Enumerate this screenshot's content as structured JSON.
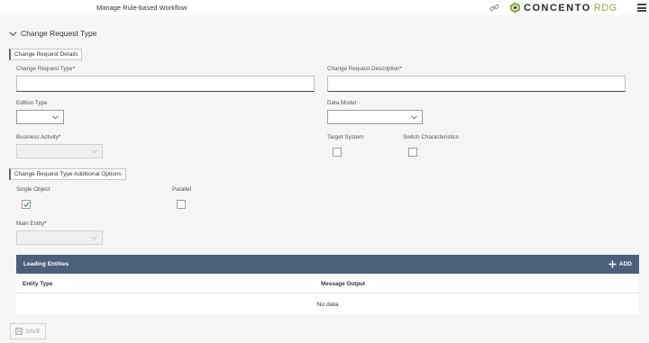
{
  "header": {
    "title": "Manage Rule-based Workflow",
    "brand": "CONCENTO",
    "brand_suffix": "RDG"
  },
  "section": {
    "title": "Change Request Type"
  },
  "details_group": {
    "label": "Change Request Details"
  },
  "fields": {
    "cr_type": {
      "label": "Change Request Type",
      "required": "*",
      "value": ""
    },
    "cr_description": {
      "label": "Change Request Description",
      "required": "*",
      "value": ""
    },
    "edition_type": {
      "label": "Edition Type",
      "value": ""
    },
    "data_model": {
      "label": "Data Model",
      "value": ""
    },
    "business_activity": {
      "label": "Business Activity",
      "required": "*",
      "value": ""
    },
    "target_system": {
      "label": "Target System",
      "checked": false
    },
    "switch_characteristics": {
      "label": "Switch Characteristics",
      "checked": false
    }
  },
  "options_group": {
    "label": "Change Request Type Additional Options"
  },
  "options": {
    "single_object": {
      "label": "Single Object",
      "checked": true
    },
    "parallel": {
      "label": "Parallel",
      "checked": false
    },
    "main_entity": {
      "label": "Main Entity",
      "required": "*",
      "value": ""
    }
  },
  "table": {
    "title": "Leading Entities",
    "add_label": "ADD",
    "columns": [
      "Entity Type",
      "Message Output"
    ],
    "empty_text": "No data"
  },
  "footer": {
    "save_label": "SAVE"
  },
  "colors": {
    "header_bar": "#4a5f7a",
    "required": "#bb0000",
    "brand_green": "#8db43a",
    "input_focus": "#3f3c9e"
  }
}
